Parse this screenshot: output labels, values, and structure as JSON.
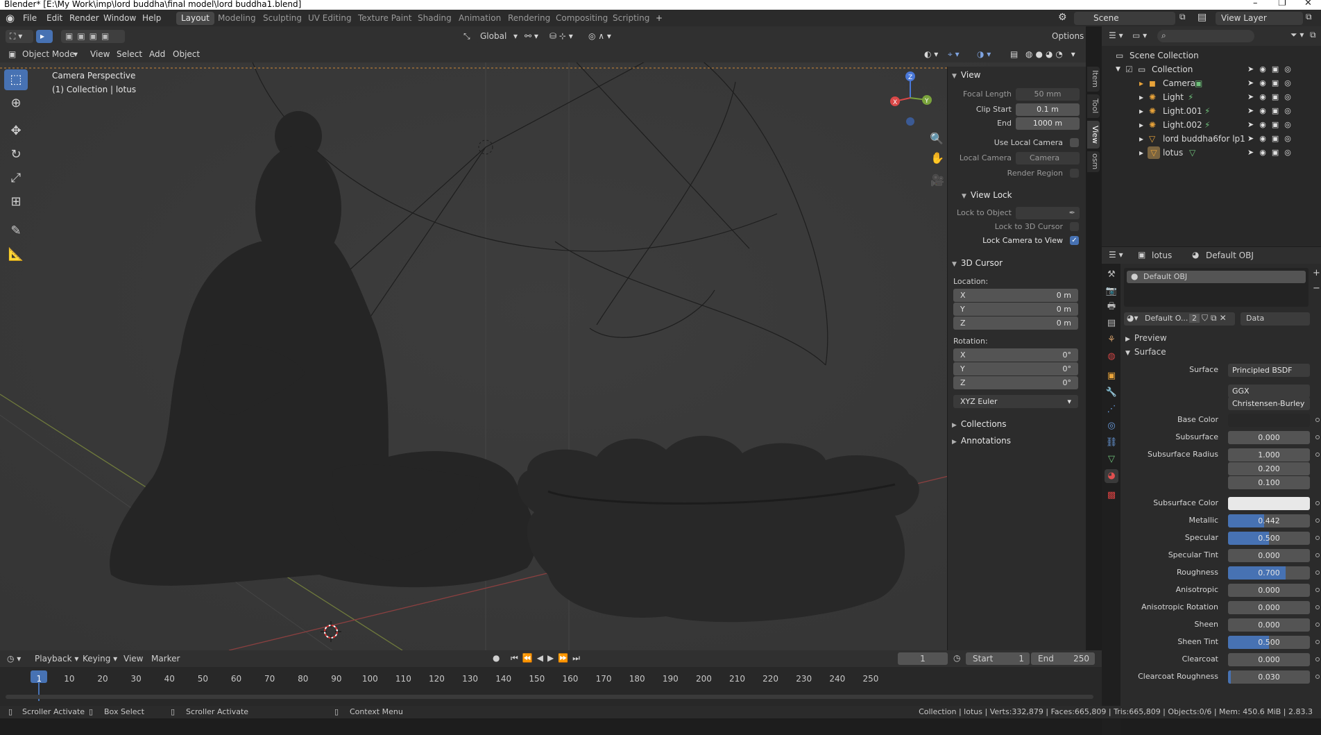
{
  "window": {
    "title": "Blender* [E:\\My Work\\imp\\lord buddha\\final model\\lord buddha1.blend]"
  },
  "menu": [
    "File",
    "Edit",
    "Render",
    "Window",
    "Help"
  ],
  "workspaces": [
    "Layout",
    "Modeling",
    "Sculpting",
    "UV Editing",
    "Texture Paint",
    "Shading",
    "Animation",
    "Rendering",
    "Compositing",
    "Scripting",
    "+"
  ],
  "topright": {
    "scene": "Scene",
    "view_layer": "View Layer"
  },
  "viewport": {
    "header": {
      "mode": "Object Mode",
      "menus": [
        "View",
        "Select",
        "Add",
        "Object"
      ],
      "orientation": "Global",
      "options": "Options"
    },
    "info_line1": "Camera Perspective",
    "info_line2": "(1) Collection | lotus"
  },
  "npanel": {
    "tabs": [
      "Item",
      "Tool",
      "View",
      "osm"
    ],
    "view_title": "View",
    "focal_length_label": "Focal Length",
    "focal_length": "50 mm",
    "clip_start_label": "Clip Start",
    "clip_start": "0.1 m",
    "clip_end_label": "End",
    "clip_end": "1000 m",
    "use_local_camera": "Use Local Camera",
    "local_camera_label": "Local Camera",
    "local_camera": "Camera",
    "render_region": "Render Region",
    "view_lock_title": "View Lock",
    "lock_to_object": "Lock to Object",
    "lock_to_3d_cursor": "Lock to 3D Cursor",
    "lock_camera_to_view": "Lock Camera to View",
    "cursor_title": "3D Cursor",
    "location_label": "Location:",
    "loc_x_label": "X",
    "loc_x": "0 m",
    "loc_y_label": "Y",
    "loc_y": "0 m",
    "loc_z_label": "Z",
    "loc_z": "0 m",
    "rotation_label": "Rotation:",
    "rot_x_label": "X",
    "rot_x": "0°",
    "rot_y_label": "Y",
    "rot_y": "0°",
    "rot_z_label": "Z",
    "rot_z": "0°",
    "rotation_mode": "XYZ Euler",
    "collections": "Collections",
    "annotations": "Annotations"
  },
  "outliner": {
    "root": "Scene Collection",
    "collection": "Collection",
    "items": [
      "Camera",
      "Light",
      "Light.001",
      "Light.002",
      "lord buddha6for lp1",
      "lotus"
    ]
  },
  "properties": {
    "object": "lotus",
    "material": "Default OBJ",
    "slot": "Default OBJ",
    "datablock": "Default O...",
    "users": "2",
    "link": "Data",
    "preview": "Preview",
    "surface_section": "Surface",
    "surface_label": "Surface",
    "surface_shader": "Principled BSDF",
    "distribution": "GGX",
    "subsurface_method": "Christensen-Burley",
    "fields": [
      {
        "label": "Base Color",
        "value": "",
        "fill": 0
      },
      {
        "label": "Subsurface",
        "value": "0.000",
        "fill": 0
      },
      {
        "label": "Subsurface Radius",
        "value": "1.000",
        "fill": 0
      },
      {
        "label": "",
        "value": "0.200",
        "fill": 0
      },
      {
        "label": "",
        "value": "0.100",
        "fill": 0
      },
      {
        "label": "Subsurface Color",
        "value": "",
        "fill": 0
      },
      {
        "label": "Metallic",
        "value": "0.442",
        "fill": 0.442
      },
      {
        "label": "Specular",
        "value": "0.500",
        "fill": 0.5
      },
      {
        "label": "Specular Tint",
        "value": "0.000",
        "fill": 0
      },
      {
        "label": "Roughness",
        "value": "0.700",
        "fill": 0.7
      },
      {
        "label": "Anisotropic",
        "value": "0.000",
        "fill": 0
      },
      {
        "label": "Anisotropic Rotation",
        "value": "0.000",
        "fill": 0
      },
      {
        "label": "Sheen",
        "value": "0.000",
        "fill": 0
      },
      {
        "label": "Sheen Tint",
        "value": "0.500",
        "fill": 0.5
      },
      {
        "label": "Clearcoat",
        "value": "0.000",
        "fill": 0
      },
      {
        "label": "Clearcoat Roughness",
        "value": "0.030",
        "fill": 0.03
      }
    ]
  },
  "timeline": {
    "menus": [
      "Playback",
      "Keying",
      "View",
      "Marker"
    ],
    "current_frame": "1",
    "start_label": "Start",
    "start": "1",
    "end_label": "End",
    "end": "250",
    "ticks": [
      "1",
      "10",
      "20",
      "30",
      "40",
      "50",
      "60",
      "70",
      "80",
      "90",
      "100",
      "110",
      "120",
      "130",
      "140",
      "150",
      "160",
      "170",
      "180",
      "190",
      "200",
      "210",
      "220",
      "230",
      "240",
      "250"
    ]
  },
  "statusbar": {
    "scroller1": "Scroller Activate",
    "box_select": "Box Select",
    "scroller2": "Scroller Activate",
    "context_menu": "Context Menu",
    "stats": "Collection | lotus | Verts:332,879 | Faces:665,809 | Tris:665,809 | Objects:0/6 | Mem: 450.6 MiB | 2.83.3"
  },
  "colors": {
    "accent": "#4772b3",
    "selected_orange": "#e8a33a",
    "viewport_bg": "#393939"
  }
}
